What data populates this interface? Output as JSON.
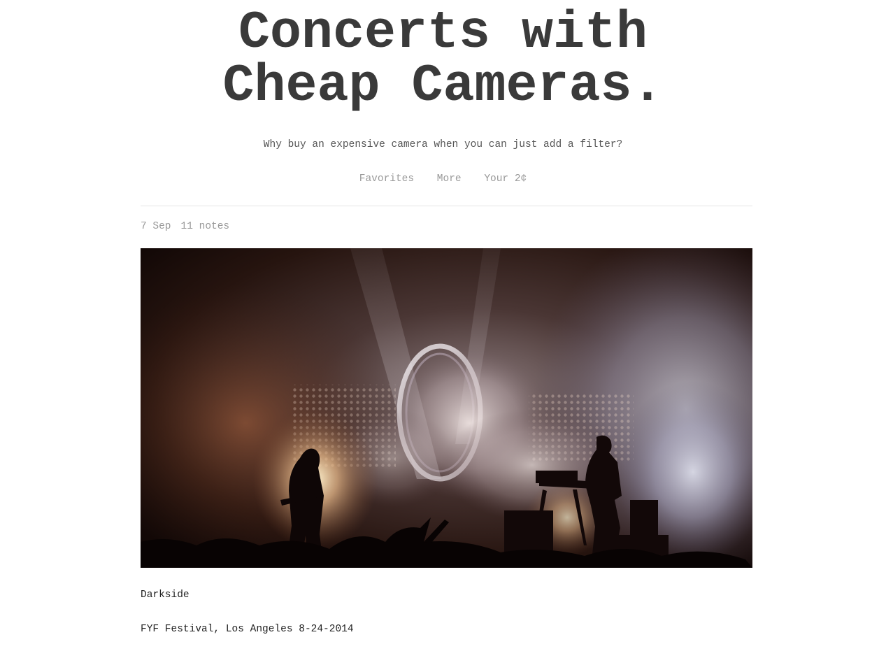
{
  "header": {
    "title_line1": "Concerts with",
    "title_line2": "Cheap Cameras.",
    "tagline": "Why buy an expensive camera when you can just add a filter?"
  },
  "nav": {
    "items": [
      {
        "label": "Favorites"
      },
      {
        "label": "More"
      },
      {
        "label": "Your 2¢"
      }
    ]
  },
  "post": {
    "date": "7 Sep",
    "notes": "11 notes",
    "photo_icon": "concert-photo",
    "caption_title": "Darkside",
    "caption_detail": "FYF Festival, Los Angeles 8-24-2014"
  },
  "colors": {
    "text": "#3a3a3a",
    "muted": "#999999",
    "divider": "#e6e6e6"
  }
}
